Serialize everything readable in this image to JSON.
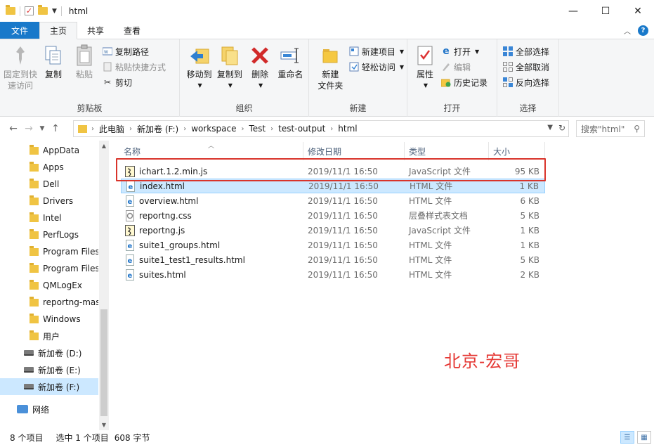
{
  "window": {
    "title": "html",
    "controls": [
      "—",
      "☐",
      "✕"
    ]
  },
  "tabs": [
    {
      "label": "文件"
    },
    {
      "label": "主页"
    },
    {
      "label": "共享"
    },
    {
      "label": "查看"
    }
  ],
  "ribbon": {
    "clipboard": {
      "label": "剪贴板",
      "pin": "固定到快\n速访问",
      "copy": "复制",
      "paste": "粘贴",
      "copy_path": "复制路径",
      "paste_shortcut": "粘贴快捷方式",
      "cut": "剪切"
    },
    "organize": {
      "label": "组织",
      "move_to": "移动到",
      "copy_to": "复制到",
      "delete": "删除",
      "rename": "重命名"
    },
    "new": {
      "label": "新建",
      "new_folder": "新建\n文件夹",
      "new_item": "新建项目",
      "easy_access": "轻松访问"
    },
    "open": {
      "label": "打开",
      "properties": "属性",
      "open": "打开",
      "edit": "编辑",
      "history": "历史记录"
    },
    "select": {
      "label": "选择",
      "select_all": "全部选择",
      "select_none": "全部取消",
      "invert": "反向选择"
    }
  },
  "address": {
    "crumbs": [
      "此电脑",
      "新加卷 (F:)",
      "workspace",
      "Test",
      "test-output",
      "html"
    ],
    "search_placeholder": "搜索\"html\""
  },
  "nav": {
    "items": [
      {
        "label": "AppData",
        "kind": "folder"
      },
      {
        "label": "Apps",
        "kind": "folder"
      },
      {
        "label": "Dell",
        "kind": "folder"
      },
      {
        "label": "Drivers",
        "kind": "folder"
      },
      {
        "label": "Intel",
        "kind": "folder"
      },
      {
        "label": "PerfLogs",
        "kind": "folder"
      },
      {
        "label": "Program Files",
        "kind": "folder"
      },
      {
        "label": "Program Files",
        "kind": "folder"
      },
      {
        "label": "QMLogEx",
        "kind": "folder"
      },
      {
        "label": "reportng-mas",
        "kind": "folder"
      },
      {
        "label": "Windows",
        "kind": "folder"
      },
      {
        "label": "用户",
        "kind": "folder"
      },
      {
        "label": "新加卷 (D:)",
        "kind": "drive"
      },
      {
        "label": "新加卷 (E:)",
        "kind": "drive"
      },
      {
        "label": "新加卷 (F:)",
        "kind": "drive",
        "selected": true
      },
      {
        "label": "网络",
        "kind": "network"
      }
    ]
  },
  "columns": {
    "name": "名称",
    "date": "修改日期",
    "type": "类型",
    "size": "大小"
  },
  "files": [
    {
      "name": "ichart.1.2.min.js",
      "date": "2019/11/1 16:50",
      "type": "JavaScript 文件",
      "size": "95 KB",
      "icon": "js"
    },
    {
      "name": "index.html",
      "date": "2019/11/1 16:50",
      "type": "HTML 文件",
      "size": "1 KB",
      "icon": "html",
      "selected": true
    },
    {
      "name": "overview.html",
      "date": "2019/11/1 16:50",
      "type": "HTML 文件",
      "size": "6 KB",
      "icon": "html"
    },
    {
      "name": "reportng.css",
      "date": "2019/11/1 16:50",
      "type": "层叠样式表文档",
      "size": "5 KB",
      "icon": "css"
    },
    {
      "name": "reportng.js",
      "date": "2019/11/1 16:50",
      "type": "JavaScript 文件",
      "size": "1 KB",
      "icon": "js"
    },
    {
      "name": "suite1_groups.html",
      "date": "2019/11/1 16:50",
      "type": "HTML 文件",
      "size": "1 KB",
      "icon": "html"
    },
    {
      "name": "suite1_test1_results.html",
      "date": "2019/11/1 16:50",
      "type": "HTML 文件",
      "size": "5 KB",
      "icon": "html"
    },
    {
      "name": "suites.html",
      "date": "2019/11/1 16:50",
      "type": "HTML 文件",
      "size": "2 KB",
      "icon": "html"
    }
  ],
  "watermark": "北京-宏哥",
  "status": {
    "count": "8 个项目",
    "selection": "选中 1 个项目",
    "size": "608 字节"
  },
  "colors": {
    "accent": "#1979ca",
    "selection": "#cce8ff",
    "highlight_box": "#d9342b",
    "watermark": "#e53935"
  }
}
